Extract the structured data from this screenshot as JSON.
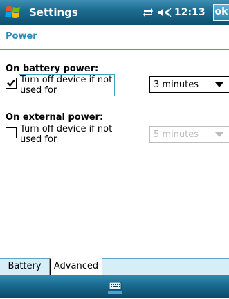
{
  "title_bar": {
    "app_title": "Settings",
    "time": "12:13",
    "ok_label": "ok",
    "icons": [
      "windows-start-icon",
      "connectivity-icon",
      "volume-icon"
    ]
  },
  "page": {
    "title": "Power"
  },
  "battery_section": {
    "title": "On battery power:",
    "checkbox_checked": true,
    "checkbox_label_line1": "Turn off device if not",
    "checkbox_label_line2": "used for",
    "dropdown_value": "3 minutes",
    "dropdown_enabled": true
  },
  "external_section": {
    "title": "On external power:",
    "checkbox_checked": false,
    "checkbox_label_line1": "Turn off device if not",
    "checkbox_label_line2": "used for",
    "dropdown_value": "5 minutes",
    "dropdown_enabled": false
  },
  "tabs": [
    {
      "label": "Battery",
      "selected": false
    },
    {
      "label": "Advanced",
      "selected": true
    }
  ],
  "command_bar": {
    "icons": [
      "keyboard-icon"
    ]
  },
  "colors": {
    "title_bar": "#1d6d92",
    "page_title": "#2d8bb6",
    "accent_border": "#3aa4c8",
    "tab_strip": "#d6eef8",
    "disabled_text": "#bcbcbc"
  }
}
